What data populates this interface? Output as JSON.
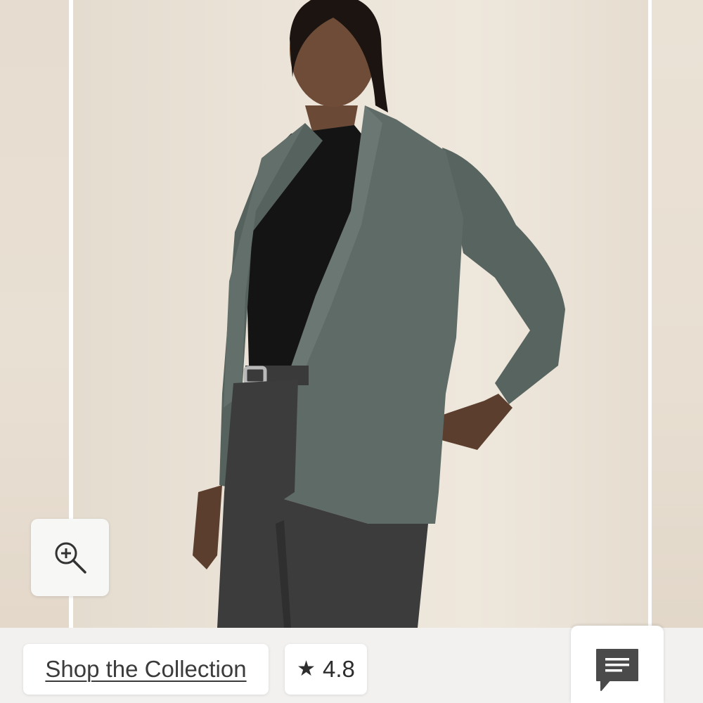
{
  "gallery": {
    "image_alt": "Model wearing a green open-front jacket over a black top with dark jeans",
    "icons": {
      "zoom": "zoom-in-icon",
      "chat": "chat-icon",
      "rating": "star-icon"
    }
  },
  "bottom_bar": {
    "shop_label": "Shop the Collection",
    "rating_star": "★",
    "rating_value": "4.8"
  },
  "colors": {
    "jacket": "#5f6b66",
    "top": "#141414",
    "jeans": "#3c3c3d",
    "backdrop": "#ebe3d7",
    "chat_icon": "#4a4a4a"
  }
}
